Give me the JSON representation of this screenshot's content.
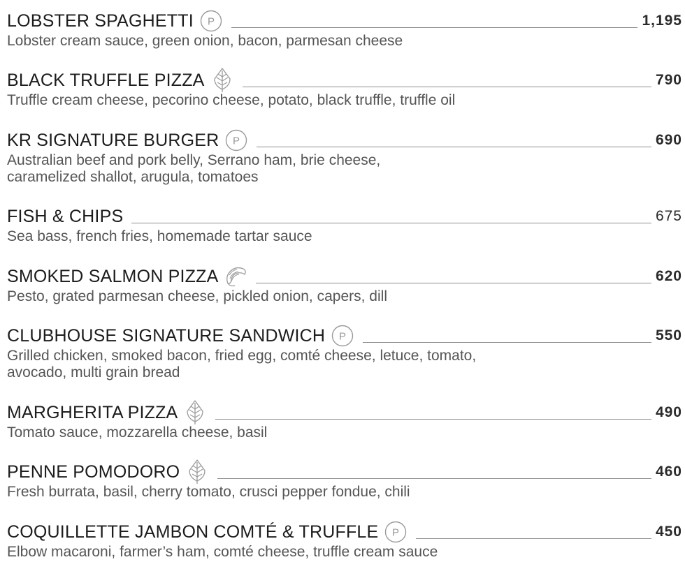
{
  "items": [
    {
      "name": "LOBSTER SPAGHETTI",
      "icon": "p-badge-icon",
      "price": "1,195",
      "desc": [
        "Lobster cream sauce, green onion, bacon, parmesan cheese"
      ]
    },
    {
      "name": "BLACK TRUFFLE PIZZA",
      "icon": "leaf-icon",
      "price": "790",
      "desc": [
        "Truffle cream cheese, pecorino cheese, potato, black truffle, truffle oil"
      ]
    },
    {
      "name": "KR SIGNATURE BURGER",
      "icon": "p-badge-icon",
      "price": "690",
      "desc": [
        "Australian beef and pork belly, Serrano ham, brie cheese,",
        "caramelized shallot, arugula, tomatoes"
      ]
    },
    {
      "name": "FISH & CHIPS",
      "icon": "",
      "price": "675",
      "desc": [
        "Sea bass, french fries, homemade tartar sauce"
      ]
    },
    {
      "name": "SMOKED SALMON PIZZA",
      "icon": "shrimp-icon",
      "price": "620",
      "desc": [
        "Pesto, grated parmesan cheese, pickled onion, capers, dill"
      ]
    },
    {
      "name": "CLUBHOUSE SIGNATURE SANDWICH",
      "icon": "p-badge-icon",
      "price": "550",
      "desc": [
        "Grilled chicken, smoked bacon, fried egg, comté cheese, letuce, tomato,",
        "avocado, multi grain bread"
      ]
    },
    {
      "name": "MARGHERITA PIZZA",
      "icon": "leaf-icon",
      "price": "490",
      "desc": [
        "Tomato sauce, mozzarella cheese, basil"
      ]
    },
    {
      "name": "PENNE POMODORO",
      "icon": "leaf-icon",
      "price": "460",
      "desc": [
        "Fresh burrata, basil, cherry tomato, crusci pepper fondue, chili"
      ]
    },
    {
      "name": "COQUILLETTE JAMBON COMTÉ & TRUFFLE",
      "icon": "p-badge-icon",
      "price": "450",
      "desc": [
        "Elbow macaroni, farmer’s ham, comté cheese, truffle cream sauce"
      ]
    }
  ],
  "icon_badge_letter": "P",
  "colors": {
    "text": "#1c1c1c",
    "desc": "#555555",
    "leader": "#8f8f8f",
    "icon": "#9a9a9a"
  }
}
